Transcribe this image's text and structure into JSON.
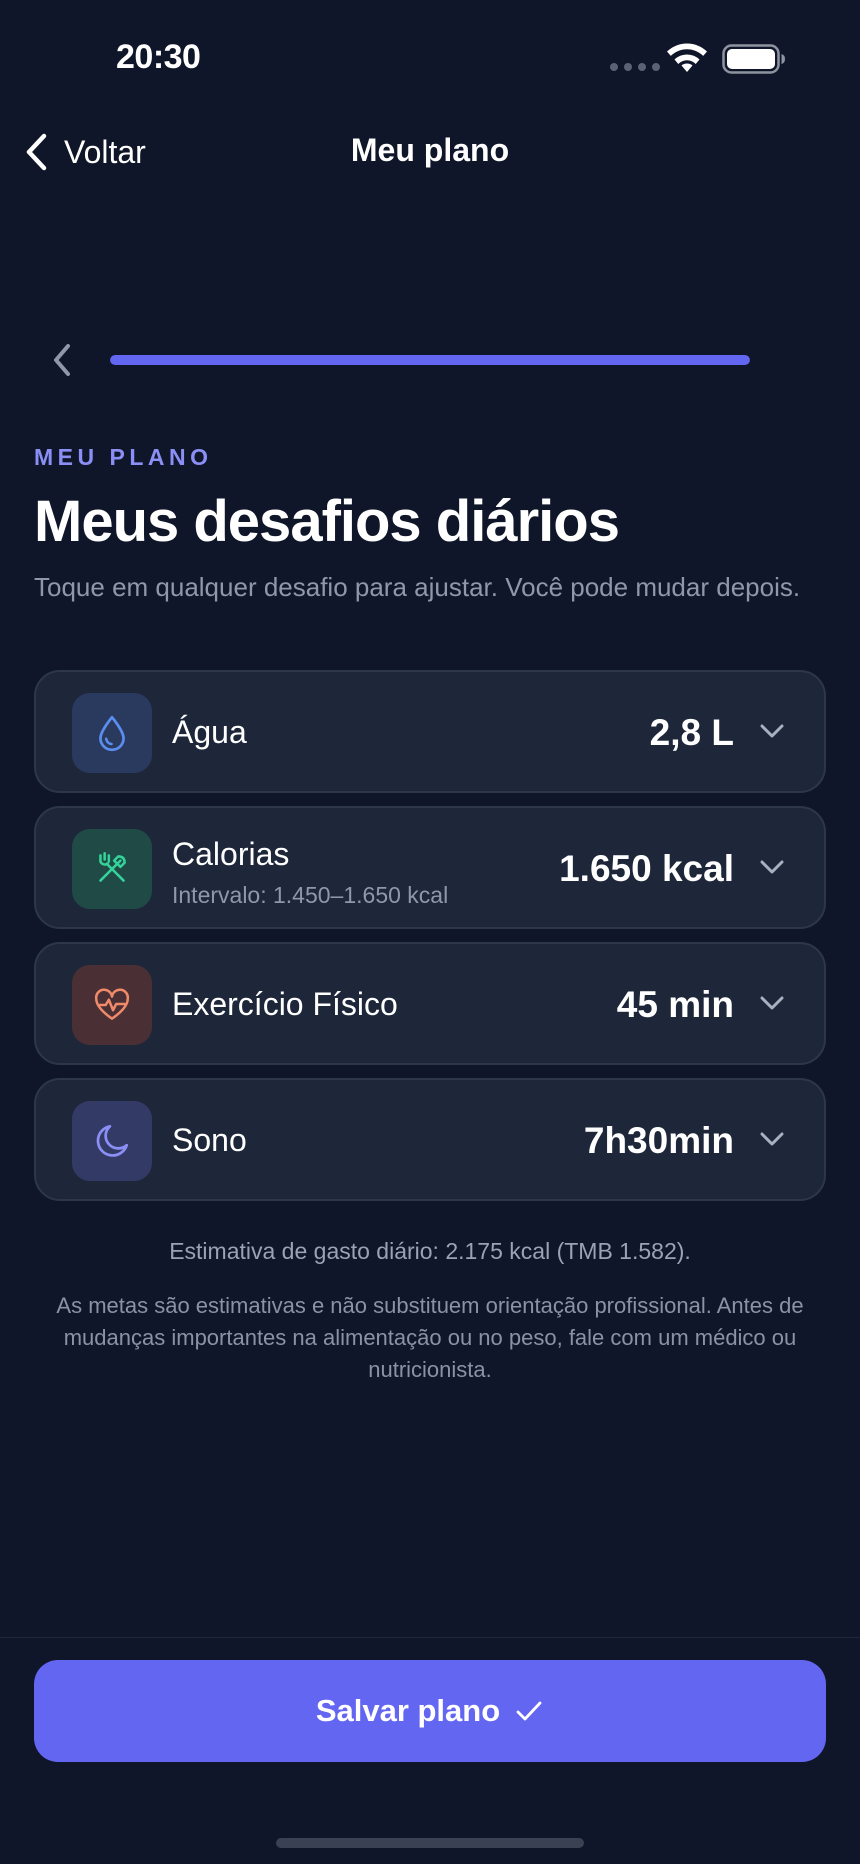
{
  "status_bar": {
    "time": "20:30"
  },
  "nav": {
    "back_label": "Voltar",
    "title": "Meu plano"
  },
  "progress": {
    "fraction": 1.0
  },
  "header": {
    "eyebrow": "MEU PLANO",
    "title": "Meus desafios diários",
    "subtitle": "Toque em qualquer desafio para ajustar. Você pode mudar depois."
  },
  "challenges": [
    {
      "title": "Água",
      "subtitle": "",
      "value": "2,8 L",
      "icon": "water-drop-icon",
      "icon_bg": "#2a3a5e",
      "icon_color": "#5b8def"
    },
    {
      "title": "Calorias",
      "subtitle": "Intervalo: 1.450–1.650 kcal",
      "value": "1.650 kcal",
      "icon": "fork-knife-icon",
      "icon_bg": "#1f4a45",
      "icon_color": "#34d399"
    },
    {
      "title": "Exercício Físico",
      "subtitle": "",
      "value": "45 min",
      "icon": "heart-pulse-icon",
      "icon_bg": "#4a3034",
      "icon_color": "#f08a6a"
    },
    {
      "title": "Sono",
      "subtitle": "",
      "value": "7h30min",
      "icon": "moon-icon",
      "icon_bg": "#343a66",
      "icon_color": "#8b8ff5"
    }
  ],
  "footer": {
    "estimate": "Estimativa de gasto diário: 2.175 kcal (TMB 1.582).",
    "disclaimer": "As metas são estimativas e não substituem orientação profissional. Antes de mudanças importantes na alimentação ou no peso, fale com um médico ou nutricionista."
  },
  "actions": {
    "save_label": "Salvar plano"
  },
  "colors": {
    "background": "#0f1629",
    "card": "#1e273a",
    "accent": "#6366f1",
    "eyebrow": "#8b8ff5"
  }
}
